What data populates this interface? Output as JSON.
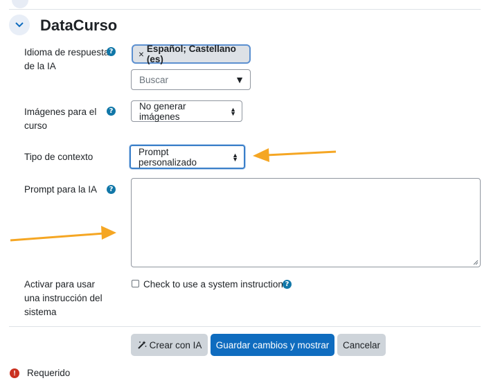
{
  "section": {
    "title": "DataCurso"
  },
  "fields": {
    "language": {
      "label": "Idioma de respuesta de la IA",
      "help": "?",
      "chip_remove": "×",
      "chip_text": "Español; Castellano (es)",
      "search_placeholder": "Buscar",
      "search_arrow": "▼"
    },
    "images": {
      "label": "Imágenes para el curso",
      "help": "?",
      "selected": "No generar imágenes"
    },
    "context": {
      "label": "Tipo de contexto",
      "selected": "Prompt personalizado"
    },
    "prompt": {
      "label": "Prompt para la IA",
      "help": "?",
      "value": ""
    },
    "system_instruction": {
      "label": "Activar para usar una instrucción del sistema",
      "checkbox_label": "Check to use a system instruction",
      "help": "?"
    }
  },
  "buttons": {
    "create_ai": "Crear con IA",
    "save_show": "Guardar cambios y mostrar",
    "cancel": "Cancelar"
  },
  "required": {
    "icon": "!",
    "text": "Requerido"
  },
  "colors": {
    "primary": "#0f6cbf",
    "annotation_arrow": "#f5a623",
    "help_icon": "#1177a8",
    "required": "#ca3120"
  },
  "icons": {
    "collapse": "chevron-down-icon",
    "create_ai": "magic-wand-icon"
  }
}
